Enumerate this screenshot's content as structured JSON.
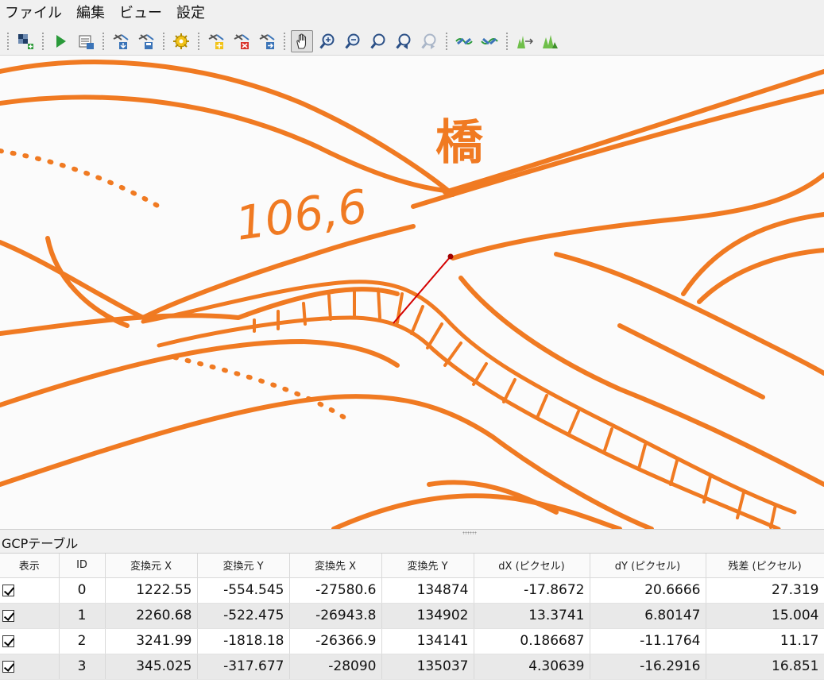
{
  "menu": [
    "ファイル",
    "編集",
    "ビュー",
    "設定"
  ],
  "toolbar": {
    "groups": [
      [
        {
          "icon": "open-raster-icon"
        }
      ],
      [
        {
          "icon": "start-georeferencing-icon"
        },
        {
          "icon": "generate-gdal-script-icon"
        }
      ],
      [
        {
          "icon": "load-gcp-points-icon"
        },
        {
          "icon": "save-gcp-points-icon"
        }
      ],
      [
        {
          "icon": "transformation-settings-icon"
        }
      ],
      [
        {
          "icon": "add-point-icon"
        },
        {
          "icon": "delete-point-icon"
        },
        {
          "icon": "move-gcp-point-icon"
        }
      ],
      [
        {
          "icon": "pan-icon",
          "active": true
        },
        {
          "icon": "zoom-in-icon"
        },
        {
          "icon": "zoom-out-icon"
        },
        {
          "icon": "zoom-to-layer-icon"
        },
        {
          "icon": "zoom-last-icon"
        },
        {
          "icon": "zoom-next-icon"
        }
      ],
      [
        {
          "icon": "link-georeferencer-to-qgis-icon"
        },
        {
          "icon": "link-qgis-to-georeferencer-icon"
        }
      ],
      [
        {
          "icon": "full-histogram-stretch-icon"
        },
        {
          "icon": "local-histogram-stretch-icon"
        }
      ]
    ]
  },
  "map": {
    "elevation_label": "106,6",
    "kanji_label": "橋",
    "line_color": "#f07a22",
    "residual_color": "#d40000"
  },
  "gcp_panel": {
    "title": "GCPテーブル",
    "columns": [
      "表示",
      "ID",
      "変換元 X",
      "変換元 Y",
      "変換先 X",
      "変換先 Y",
      "dX (ピクセル)",
      "dY (ピクセル)",
      "残差 (ピクセル)"
    ],
    "rows": [
      {
        "enabled": true,
        "id": "0",
        "src_x": "1222.55",
        "src_y": "-554.545",
        "dst_x": "-27580.6",
        "dst_y": "134874",
        "dx": "-17.8672",
        "dy": "20.6666",
        "residual": "27.319"
      },
      {
        "enabled": true,
        "id": "1",
        "src_x": "2260.68",
        "src_y": "-522.475",
        "dst_x": "-26943.8",
        "dst_y": "134902",
        "dx": "13.3741",
        "dy": "6.80147",
        "residual": "15.004"
      },
      {
        "enabled": true,
        "id": "2",
        "src_x": "3241.99",
        "src_y": "-1818.18",
        "dst_x": "-26366.9",
        "dst_y": "134141",
        "dx": "0.186687",
        "dy": "-11.1764",
        "residual": "11.17"
      },
      {
        "enabled": true,
        "id": "3",
        "src_x": "345.025",
        "src_y": "-317.677",
        "dst_x": "-28090",
        "dst_y": "135037",
        "dx": "4.30639",
        "dy": "-16.2916",
        "residual": "16.851"
      }
    ]
  }
}
